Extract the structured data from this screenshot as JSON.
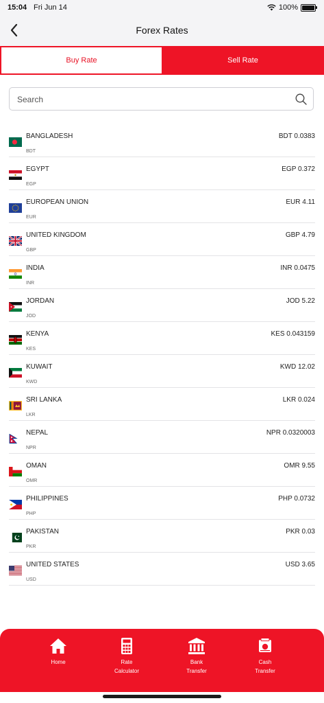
{
  "status_bar": {
    "time": "15:04",
    "date": "Fri Jun 14",
    "battery": "100%"
  },
  "header": {
    "title": "Forex Rates",
    "back_icon": "chevron-left"
  },
  "tabs": {
    "buy": "Buy Rate",
    "sell": "Sell Rate",
    "active": "buy"
  },
  "search": {
    "placeholder": "Search",
    "value": ""
  },
  "colors": {
    "brand_red": "#ee1426",
    "divider": "#e3e3e6"
  },
  "rates": [
    {
      "country": "BANGLADESH",
      "code": "BDT",
      "rate": "BDT 0.0383",
      "flag": "bangladesh"
    },
    {
      "country": "EGYPT",
      "code": "EGP",
      "rate": "EGP 0.372",
      "flag": "egypt"
    },
    {
      "country": "EUROPEAN UNION",
      "code": "EUR",
      "rate": "EUR 4.11",
      "flag": "eu"
    },
    {
      "country": "UNITED KINGDOM",
      "code": "GBP",
      "rate": "GBP 4.79",
      "flag": "uk"
    },
    {
      "country": "INDIA",
      "code": "INR",
      "rate": "INR 0.0475",
      "flag": "india"
    },
    {
      "country": "JORDAN",
      "code": "JOD",
      "rate": "JOD 5.22",
      "flag": "jordan"
    },
    {
      "country": "KENYA",
      "code": "KES",
      "rate": "KES 0.043159",
      "flag": "kenya"
    },
    {
      "country": "KUWAIT",
      "code": "KWD",
      "rate": "KWD 12.02",
      "flag": "kuwait"
    },
    {
      "country": "SRI LANKA",
      "code": "LKR",
      "rate": "LKR 0.024",
      "flag": "srilanka"
    },
    {
      "country": "NEPAL",
      "code": "NPR",
      "rate": "NPR 0.0320003",
      "flag": "nepal"
    },
    {
      "country": "OMAN",
      "code": "OMR",
      "rate": "OMR 9.55",
      "flag": "oman"
    },
    {
      "country": "PHILIPPINES",
      "code": "PHP",
      "rate": "PHP 0.0732",
      "flag": "philippines"
    },
    {
      "country": "PAKISTAN",
      "code": "PKR",
      "rate": "PKR 0.03",
      "flag": "pakistan"
    },
    {
      "country": "UNITED STATES",
      "code": "USD",
      "rate": "USD 3.65",
      "flag": "usa"
    }
  ],
  "bottom_tabs": [
    {
      "label": "Home",
      "icon": "home-icon"
    },
    {
      "label": "Rate\nCalculator",
      "icon": "calculator-icon"
    },
    {
      "label": "Bank\nTransfer",
      "icon": "bank-icon"
    },
    {
      "label": "Cash\nTransfer",
      "icon": "cash-icon"
    }
  ]
}
